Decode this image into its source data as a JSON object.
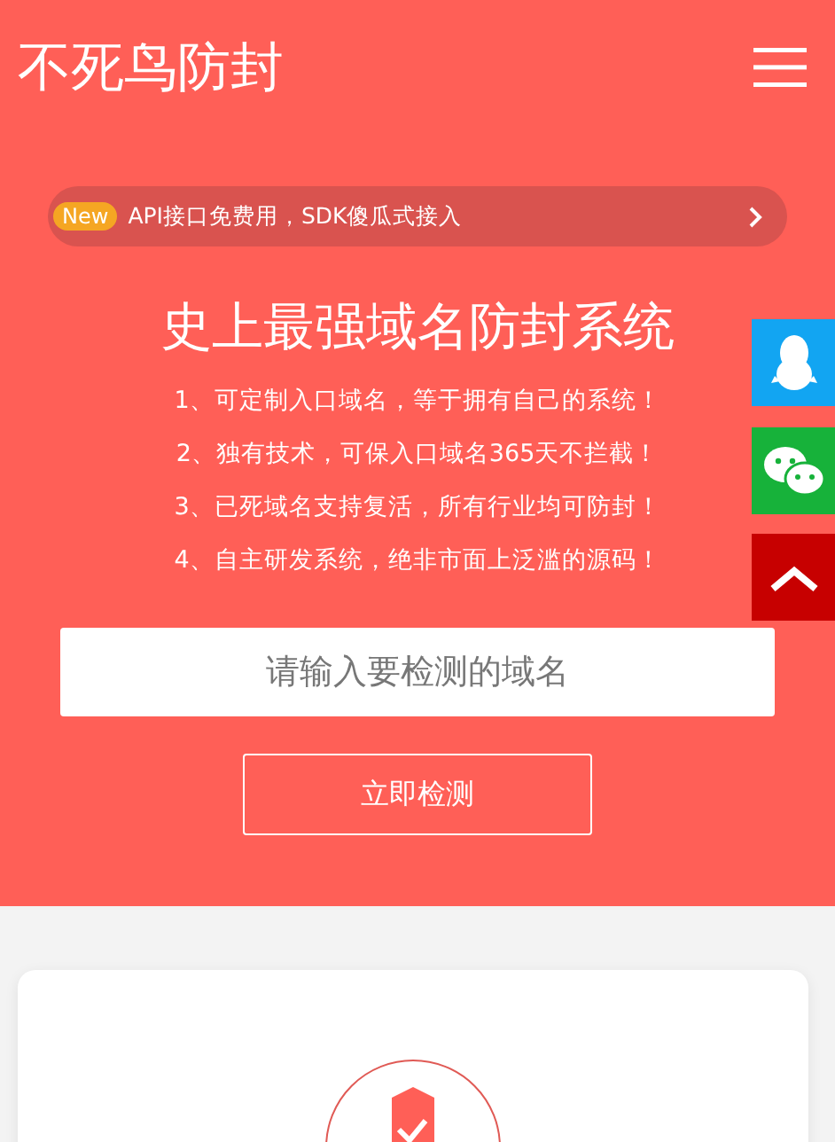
{
  "header": {
    "logo": "不死鸟防封"
  },
  "announcement": {
    "badge": "New",
    "text": "API接口免费用，SDK傻瓜式接入"
  },
  "hero": {
    "title": "史上最强域名防封系统",
    "features": [
      "1、可定制入口域名，等于拥有自己的系统！",
      "2、独有技术，可保入口域名365天不拦截！",
      "3、已死域名支持复活，所有行业均可防封！",
      "4、自主研发系统，绝非市面上泛滥的源码！"
    ],
    "search": {
      "placeholder": "请输入要检测的域名"
    },
    "button": "立即检测"
  }
}
